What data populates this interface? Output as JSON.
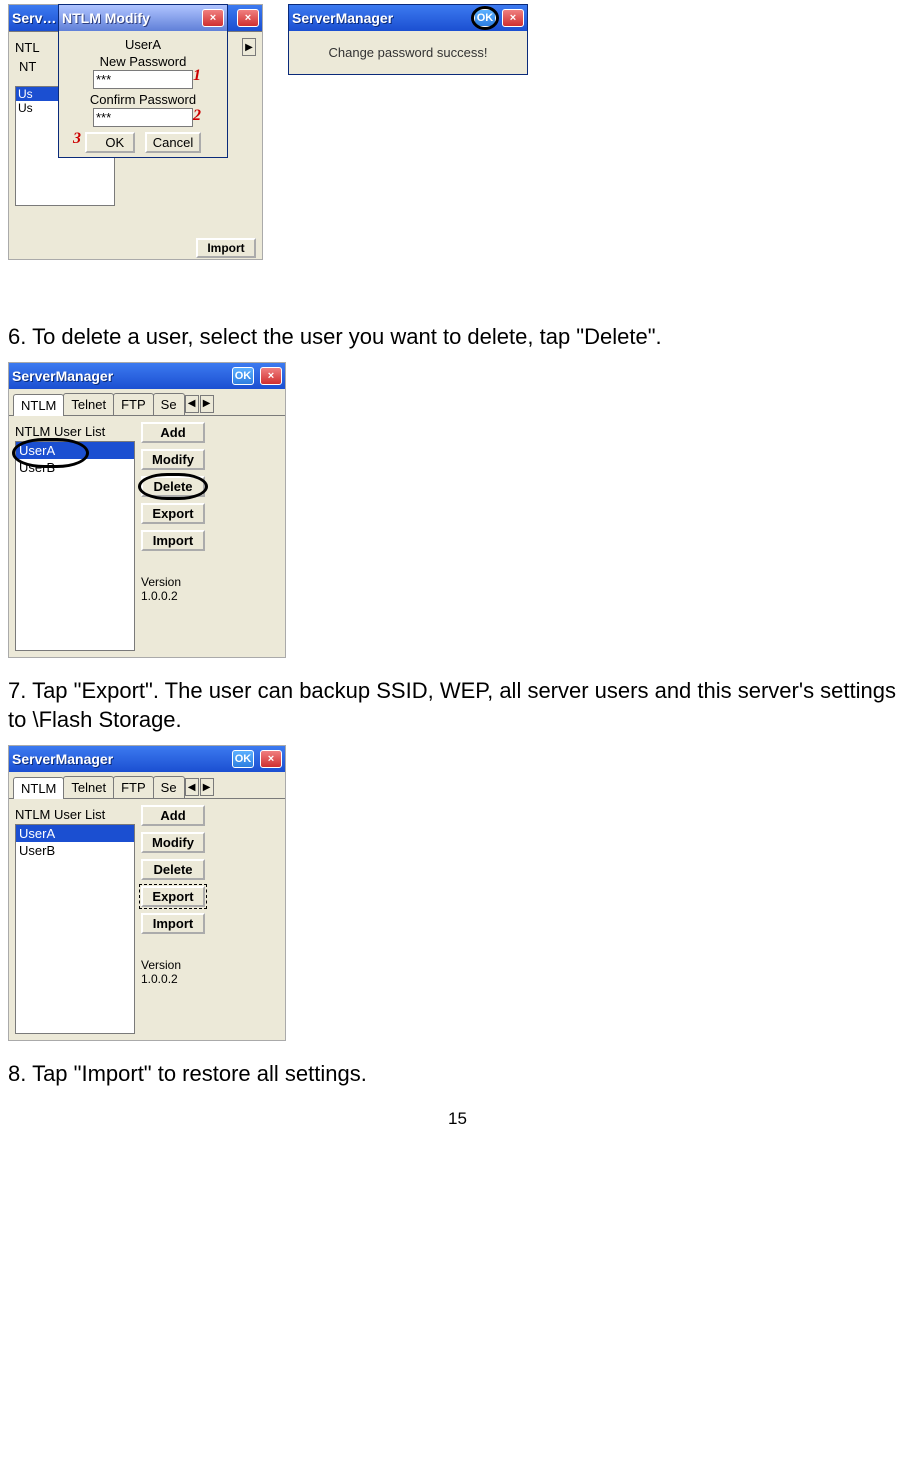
{
  "section_top": {
    "behind_window": {
      "title": "Serv…",
      "tabs": [
        "NTL",
        "NT"
      ],
      "list": [
        "Us",
        "Us"
      ],
      "buttons": {
        "import": "Import"
      }
    },
    "dlg": {
      "title": "NTLM Modify",
      "user_label": "UserA",
      "new_pw_label": "New Password",
      "new_pw_value": "***",
      "confirm_label": "Confirm Password",
      "confirm_value": "***",
      "ok": "OK",
      "cancel": "Cancel",
      "anno": {
        "one": "1",
        "two": "2",
        "three": "3"
      }
    },
    "popup": {
      "title": "ServerManager",
      "ok": "OK",
      "msg": "Change password success!"
    }
  },
  "step6": {
    "text": "6. To delete a user, select the user you want to delete, tap \"Delete\".",
    "window": {
      "title": "ServerManager",
      "ok": "OK",
      "tabs": [
        "NTLM",
        "Telnet",
        "FTP",
        "Se"
      ],
      "list_label": "NTLM User List",
      "users": [
        "UserA",
        "UserB"
      ],
      "buttons": {
        "add": "Add",
        "modify": "Modify",
        "delete": "Delete",
        "export": "Export",
        "import": "Import"
      },
      "version_label": "Version",
      "version_value": "1.0.0.2"
    }
  },
  "step7": {
    "text": "7. Tap \"Export\". The user can backup SSID, WEP, all server users and this server's settings to \\Flash Storage.",
    "window": {
      "title": "ServerManager",
      "ok": "OK",
      "tabs": [
        "NTLM",
        "Telnet",
        "FTP",
        "Se"
      ],
      "list_label": "NTLM User List",
      "users": [
        "UserA",
        "UserB"
      ],
      "buttons": {
        "add": "Add",
        "modify": "Modify",
        "delete": "Delete",
        "export": "Export",
        "import": "Import"
      },
      "version_label": "Version",
      "version_value": "1.0.0.2"
    }
  },
  "step8": {
    "text": "8. Tap \"Import\" to restore all settings."
  },
  "page_number": "15"
}
